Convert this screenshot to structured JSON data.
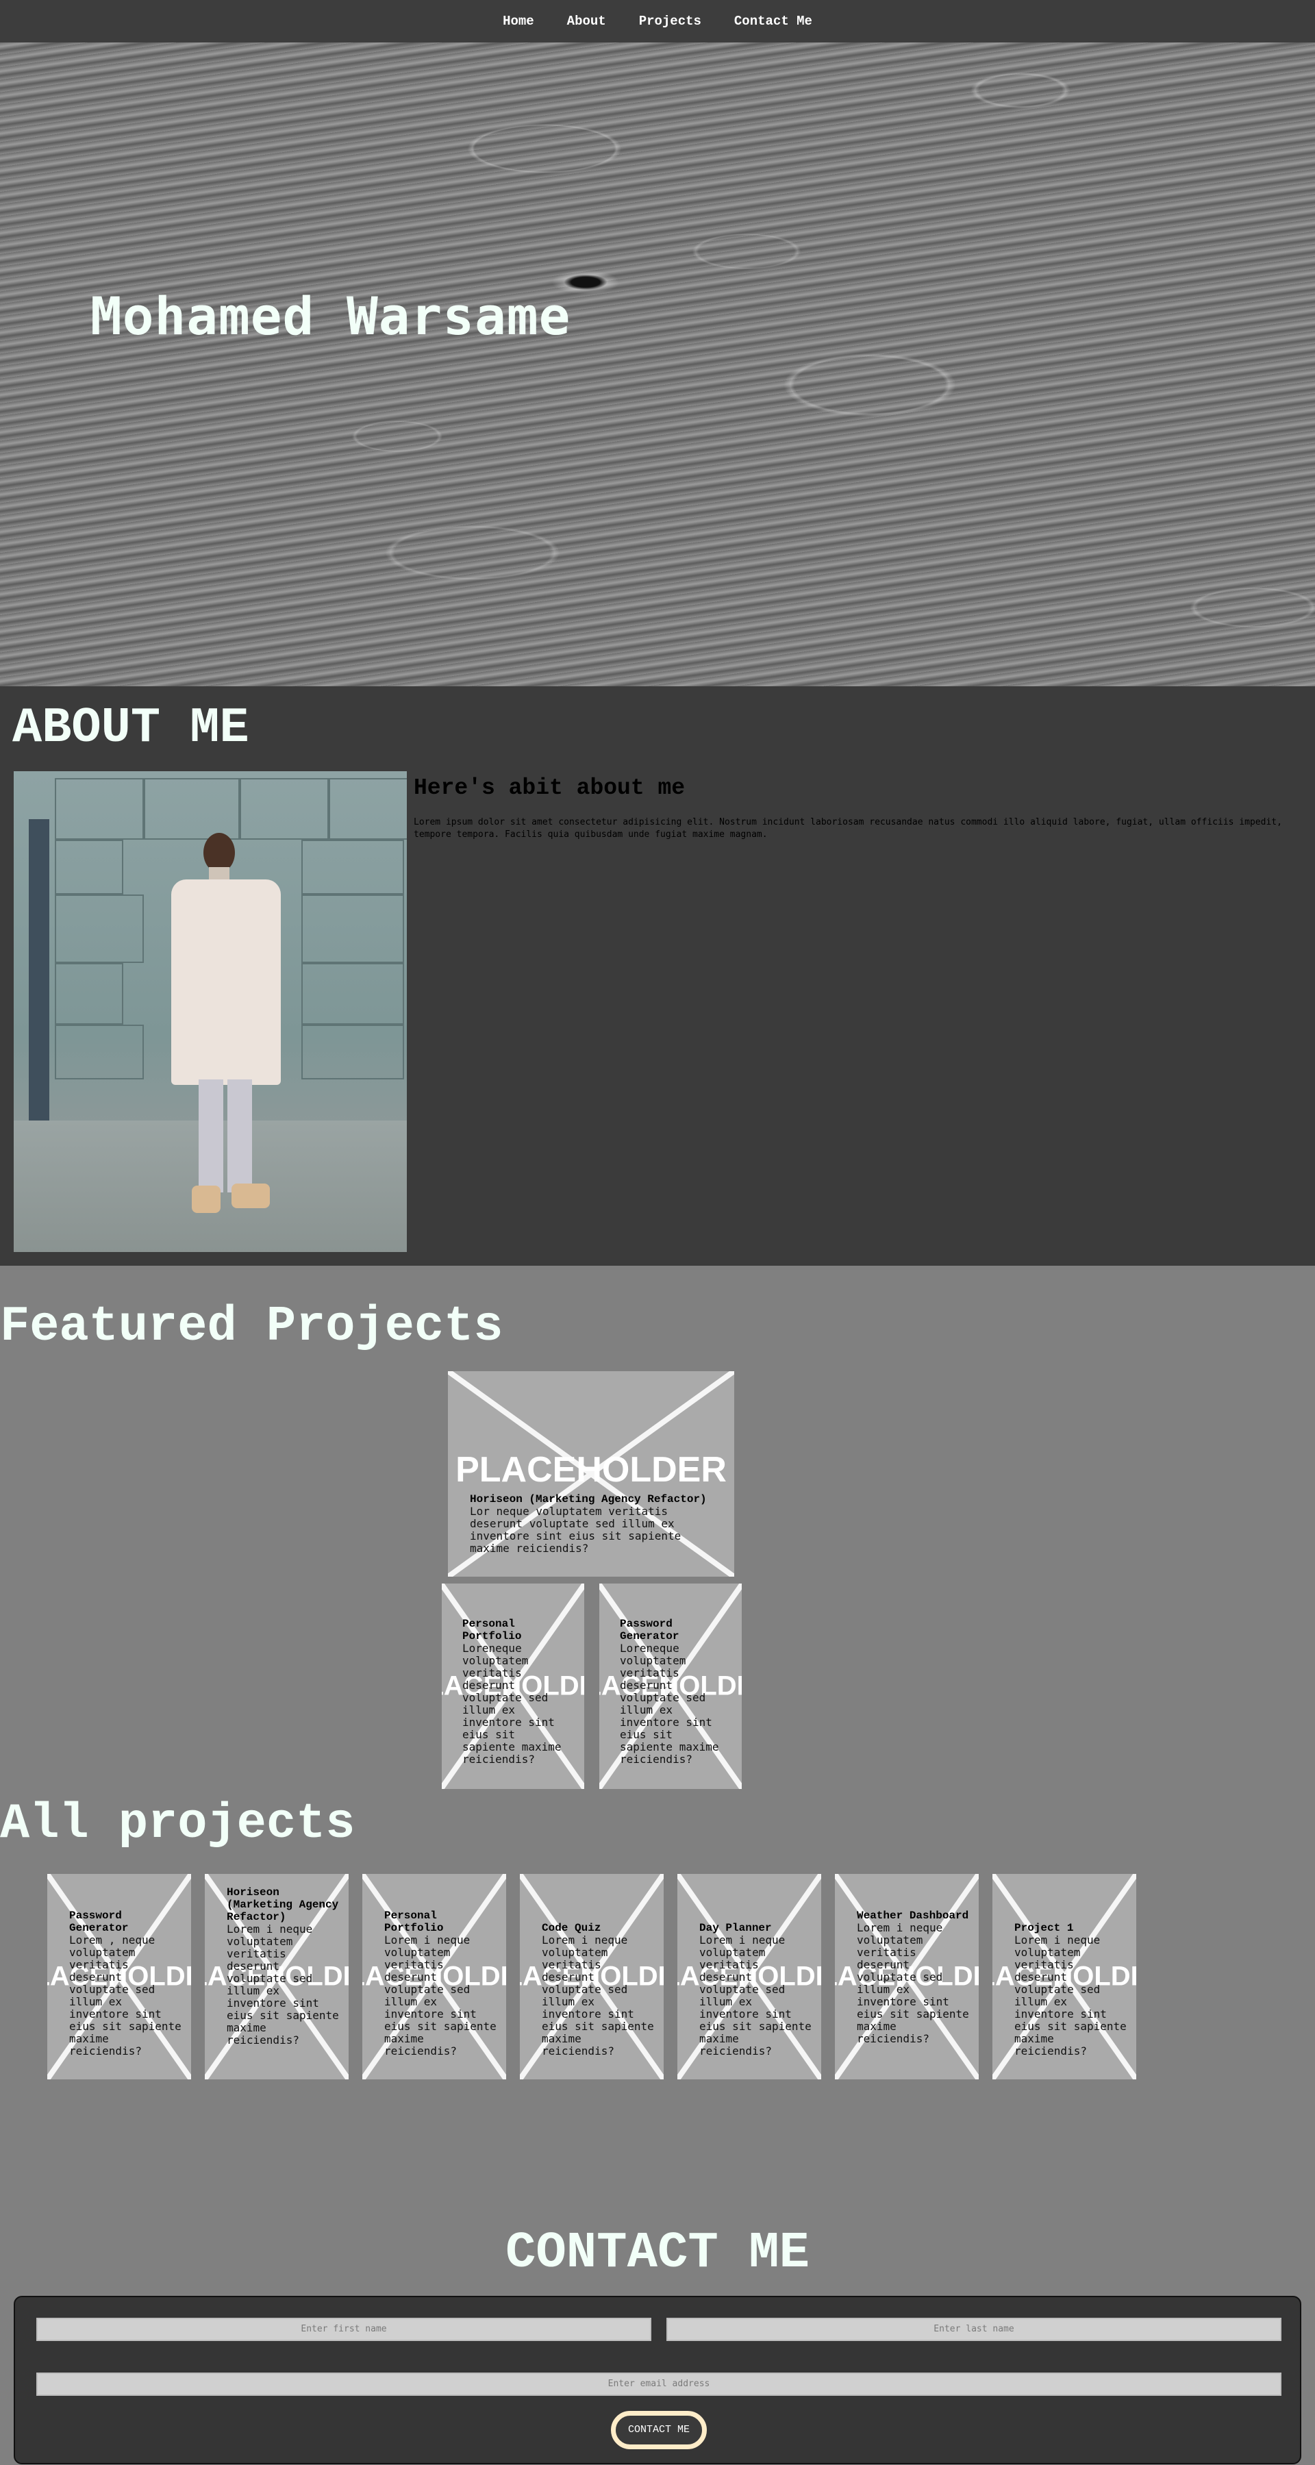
{
  "nav": {
    "items": [
      "Home",
      "About",
      "Projects",
      "Contact Me"
    ]
  },
  "hero": {
    "name": "Mohamed Warsame"
  },
  "about": {
    "title": "ABOUT ME",
    "subtitle": "Here's abit about me",
    "text": "Lorem ipsum dolor sit amet consectetur adipisicing elit. Nostrum incidunt laboriosam recusandae natus commodi illo aliquid labore, fugiat, ullam officiis impedit, tempore tempora. Facilis quia quibusdam unde fugiat maxime magnam."
  },
  "featured": {
    "title": "Featured Projects",
    "main": {
      "placeholder": "PLACEHOLDER",
      "name": "Horiseon (Marketing Agency Refactor)",
      "desc": "Lor neque voluptatem veritatis deserunt voluptate sed illum ex inventore sint eius sit sapiente maxime reiciendis?"
    },
    "small": [
      {
        "placeholder": "PLACEHOLDER",
        "name": "Personal Portfolio",
        "desc": "Loreneque voluptatem veritatis deserunt voluptate sed illum ex inventore sint eius sit sapiente maxime reiciendis?"
      },
      {
        "placeholder": "PLACEHOLDER",
        "name": "Password Generator",
        "desc": "Loreneque voluptatem veritatis deserunt voluptate sed illum ex inventore sint eius sit sapiente maxime reiciendis?"
      }
    ]
  },
  "all": {
    "title": "All projects",
    "items": [
      {
        "placeholder": "PLACEHOLDER",
        "name": "Password Generator",
        "desc": "Lorem , neque voluptatem veritatis deserunt voluptate sed illum ex inventore sint eius sit sapiente maxime reiciendis?"
      },
      {
        "placeholder": "PLACEHOLDER",
        "name": "Horiseon (Marketing Agency Refactor)",
        "desc": "Lorem i neque voluptatem veritatis deserunt voluptate sed illum ex inventore sint eius sit sapiente maxime reiciendis?"
      },
      {
        "placeholder": "PLACEHOLDER",
        "name": "Personal Portfolio",
        "desc": "Lorem i neque voluptatem veritatis deserunt voluptate sed illum ex inventore sint eius sit sapiente maxime reiciendis?"
      },
      {
        "placeholder": "PLACEHOLDER",
        "name": "Code Quiz",
        "desc": "Lorem i neque voluptatem veritatis deserunt voluptate sed illum ex inventore sint eius sit sapiente maxime reiciendis?"
      },
      {
        "placeholder": "PLACEHOLDER",
        "name": "Day Planner",
        "desc": "Lorem i neque voluptatem veritatis deserunt voluptate sed illum ex inventore sint eius sit sapiente maxime reiciendis?"
      },
      {
        "placeholder": "PLACEHOLDER",
        "name": "Weather Dashboard",
        "desc": "Lorem i neque voluptatem veritatis deserunt voluptate sed illum ex inventore sint eius sit sapiente maxime reiciendis?"
      },
      {
        "placeholder": "PLACEHOLDER",
        "name": "Project 1",
        "desc": "Lorem i neque voluptatem veritatis deserunt voluptate sed illum ex inventore sint eius sit sapiente maxime reiciendis?"
      }
    ]
  },
  "contact": {
    "title": "CONTACT ME",
    "first_name_placeholder": "Enter first name",
    "last_name_placeholder": "Enter last name",
    "email_placeholder": "Enter email address",
    "submit_label": "CONTACT ME"
  }
}
